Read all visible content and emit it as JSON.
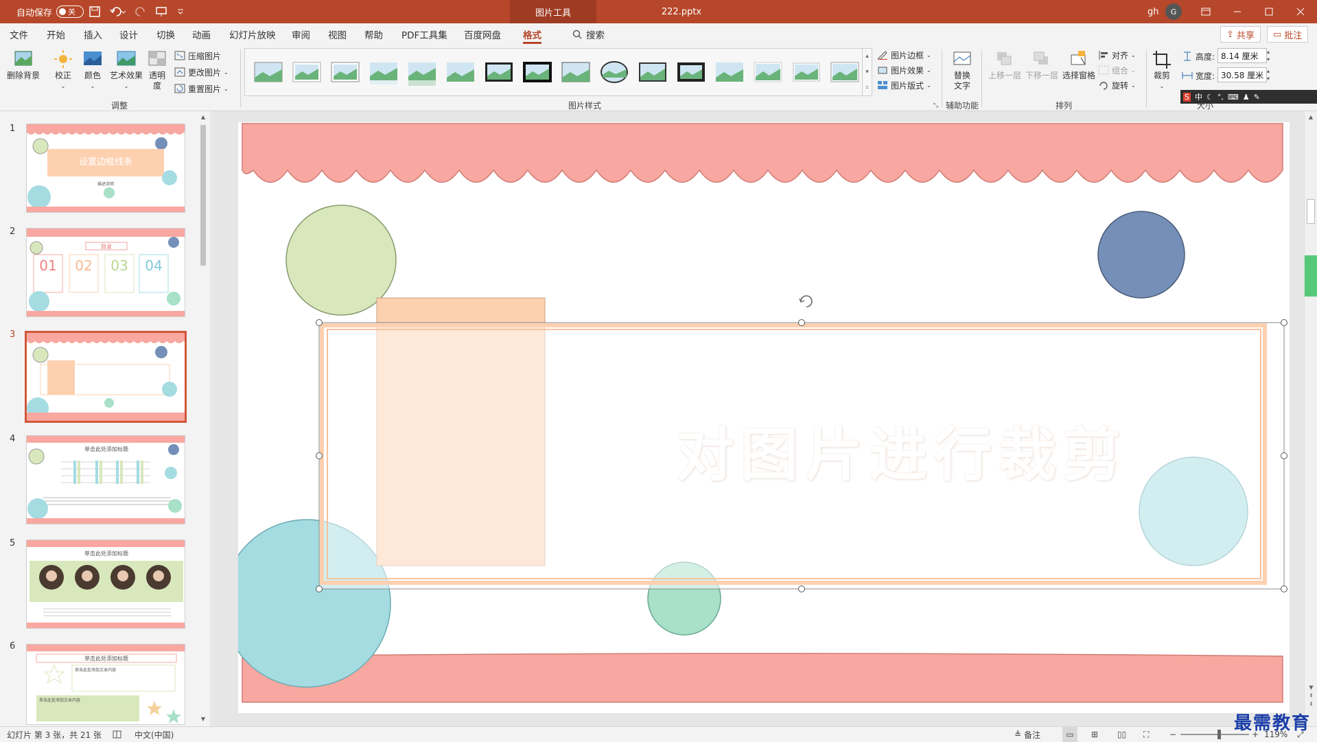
{
  "titlebar": {
    "autosave_label": "自动保存",
    "autosave_state": "关",
    "context_tab": "图片工具",
    "filename": "222.pptx",
    "user": "gh",
    "user_initial": "G"
  },
  "menu": {
    "items": [
      "文件",
      "开始",
      "插入",
      "设计",
      "切换",
      "动画",
      "幻灯片放映",
      "审阅",
      "视图",
      "帮助",
      "PDF工具集",
      "百度网盘",
      "格式"
    ],
    "active": "格式",
    "search": "搜索",
    "share": "共享",
    "comment": "批注"
  },
  "ribbon": {
    "adjust": {
      "remove_bg": "删除背景",
      "correct": "校正",
      "color": "颜色",
      "art": "艺术效果",
      "transparency_1": "透明",
      "transparency_2": "度",
      "compress": "压缩图片",
      "change": "更改图片",
      "reset": "重置图片",
      "label": "调整"
    },
    "styles_label": "图片样式",
    "border": "图片边框",
    "effects": "图片效果",
    "layout": "图片版式",
    "access": {
      "alt_text_1": "替换",
      "alt_text_2": "文字",
      "label": "辅助功能"
    },
    "arrange": {
      "bring_forward": "上移一层",
      "send_backward": "下移一层",
      "selection_pane": "选择窗格",
      "align": "对齐",
      "group": "组合",
      "rotate": "旋转",
      "label": "排列"
    },
    "size": {
      "crop": "裁剪",
      "height_label": "高度:",
      "height_value": "8.14 厘米",
      "width_label": "宽度:",
      "width_value": "30.58 厘米",
      "label": "大小"
    }
  },
  "slides": [
    {
      "num": "1",
      "title": "设置边框线条",
      "sub": "描述说明"
    },
    {
      "num": "2",
      "title": "目录",
      "nums": [
        "01",
        "02",
        "03",
        "04"
      ]
    },
    {
      "num": "3"
    },
    {
      "num": "4",
      "title": "单击此处添加标题"
    },
    {
      "num": "5",
      "title": "单击此处添加标题"
    },
    {
      "num": "6",
      "title": "单击此处添加标题",
      "text1": "单击此处添加文本内容",
      "text2": "单击此处添加文本内容"
    }
  ],
  "current_slide": {
    "title_text": "对图片进行裁剪"
  },
  "status": {
    "slide_info": "幻灯片 第 3 张，共 21 张",
    "language": "中文(中国)",
    "notes": "备注",
    "zoom": "119%"
  },
  "watermark": "最需教育",
  "colors": {
    "accent": "#b7472a",
    "pink": "#f8a8a0",
    "peach": "#fdd0b0",
    "green_circle": "#d8e8bc",
    "blue_circle": "#7590b8",
    "teal_circle": "#a4dce2",
    "mint_circle": "#a8e0c8"
  }
}
